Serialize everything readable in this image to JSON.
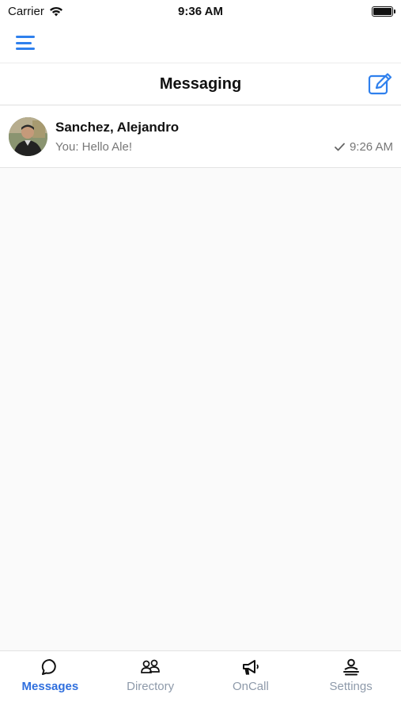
{
  "status_bar": {
    "carrier": "Carrier",
    "time": "9:36 AM"
  },
  "header": {
    "title": "Messaging"
  },
  "conversations": [
    {
      "name": "Sanchez, Alejandro",
      "preview": "You: Hello Ale!",
      "time": "9:26 AM",
      "status_icon": "checkmark-icon"
    }
  ],
  "tabs": [
    {
      "label": "Messages",
      "icon": "chat-bubble-icon",
      "active": true
    },
    {
      "label": "Directory",
      "icon": "people-icon",
      "active": false
    },
    {
      "label": "OnCall",
      "icon": "megaphone-icon",
      "active": false
    },
    {
      "label": "Settings",
      "icon": "user-settings-icon",
      "active": false
    }
  ],
  "colors": {
    "accent": "#2f80ed",
    "active_tab": "#2f6fde",
    "inactive_tab": "#8e9aaa",
    "background": "#fafafa"
  }
}
